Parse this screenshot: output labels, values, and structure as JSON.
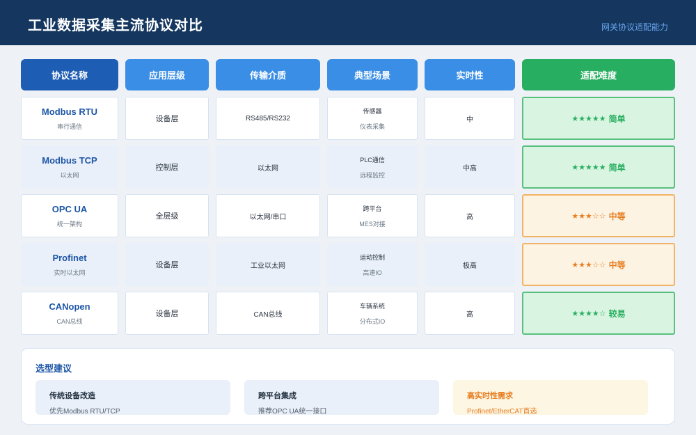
{
  "header": {
    "title": "工业数据采集主流协议对比",
    "subtitle": "网关协议适配能力"
  },
  "table": {
    "columns": [
      "协议名称",
      "应用层级",
      "传输介质",
      "典型场景",
      "实时性",
      "适配难度"
    ],
    "rows": [
      {
        "name": "Modbus RTU",
        "desc": "串行通信",
        "level": "设备层",
        "medium": "RS485/RS232",
        "scene1": "传感器",
        "scene2": "仪表采集",
        "realtime": "中",
        "stars": "★★★★★",
        "difficulty": "简单",
        "tone": "green"
      },
      {
        "name": "Modbus TCP",
        "desc": "以太网",
        "level": "控制层",
        "medium": "以太网",
        "scene1": "PLC通信",
        "scene2": "远程监控",
        "realtime": "中高",
        "stars": "★★★★★",
        "difficulty": "简单",
        "tone": "green"
      },
      {
        "name": "OPC UA",
        "desc": "统一架构",
        "level": "全层级",
        "medium": "以太网/串口",
        "scene1": "跨平台",
        "scene2": "MES对接",
        "realtime": "高",
        "stars": "★★★☆☆",
        "difficulty": "中等",
        "tone": "orange"
      },
      {
        "name": "Profinet",
        "desc": "实时以太网",
        "level": "设备层",
        "medium": "工业以太网",
        "scene1": "运动控制",
        "scene2": "高速IO",
        "realtime": "极高",
        "stars": "★★★☆☆",
        "difficulty": "中等",
        "tone": "orange"
      },
      {
        "name": "CANopen",
        "desc": "CAN总线",
        "level": "设备层",
        "medium": "CAN总线",
        "scene1": "车辆系统",
        "scene2": "分布式IO",
        "realtime": "高",
        "stars": "★★★★☆",
        "difficulty": "较易",
        "tone": "green"
      }
    ]
  },
  "advice": {
    "title": "选型建议",
    "cards": [
      {
        "title": "传统设备改造",
        "desc": "优先Modbus RTU/TCP"
      },
      {
        "title": "跨平台集成",
        "desc": "推荐OPC UA统一接口"
      },
      {
        "title": "高实时性需求",
        "desc": "Profinet/EtherCAT首选"
      }
    ]
  },
  "colors": {
    "header_bg": "#14365f",
    "primary": "#1e5db4",
    "accent": "#3a8ee6",
    "easy": "#27ae60",
    "medium": "#e67e22"
  }
}
